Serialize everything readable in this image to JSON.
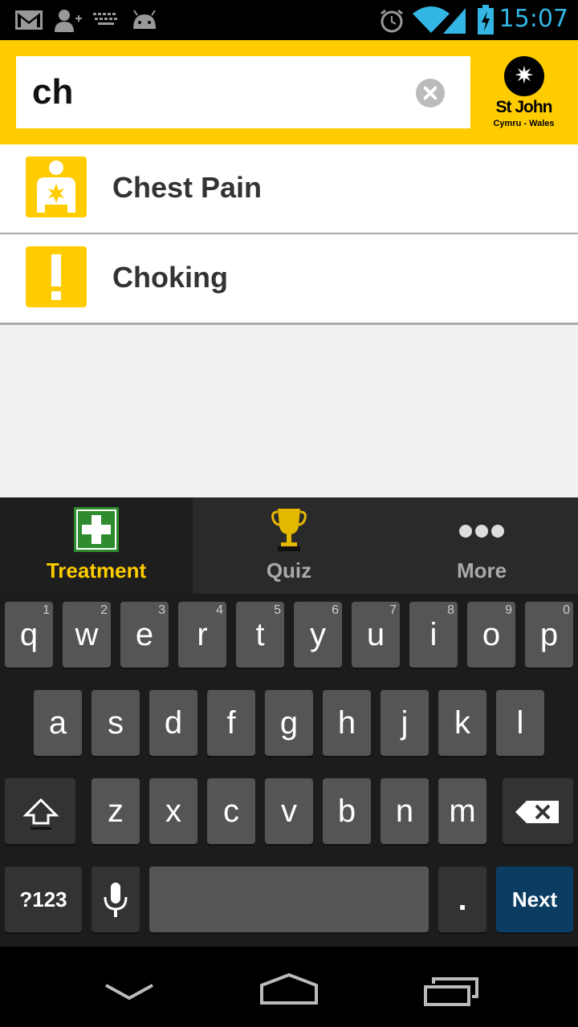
{
  "status_bar": {
    "time": "15:07",
    "icons": [
      "gmail-icon",
      "add-contact-icon",
      "keyboard-icon",
      "android-icon",
      "alarm-icon",
      "wifi-icon",
      "signal-icon",
      "battery-charging-icon"
    ]
  },
  "search": {
    "query": "ch",
    "clear_icon": "clear-search-icon"
  },
  "logo": {
    "name": "St John",
    "subtitle": "Cymru - Wales"
  },
  "results": [
    {
      "label": "Chest Pain",
      "icon": "chest-pain-icon"
    },
    {
      "label": "Choking",
      "icon": "exclamation-icon"
    }
  ],
  "tabs": [
    {
      "label": "Treatment",
      "icon": "first-aid-cross-icon",
      "active": true
    },
    {
      "label": "Quiz",
      "icon": "trophy-icon",
      "active": false
    },
    {
      "label": "More",
      "icon": "more-dots-icon",
      "active": false
    }
  ],
  "keyboard": {
    "row1": [
      {
        "k": "q",
        "n": "1"
      },
      {
        "k": "w",
        "n": "2"
      },
      {
        "k": "e",
        "n": "3"
      },
      {
        "k": "r",
        "n": "4"
      },
      {
        "k": "t",
        "n": "5"
      },
      {
        "k": "y",
        "n": "6"
      },
      {
        "k": "u",
        "n": "7"
      },
      {
        "k": "i",
        "n": "8"
      },
      {
        "k": "o",
        "n": "9"
      },
      {
        "k": "p",
        "n": "0"
      }
    ],
    "row2": [
      "a",
      "s",
      "d",
      "f",
      "g",
      "h",
      "j",
      "k",
      "l"
    ],
    "row3": [
      "z",
      "x",
      "c",
      "v",
      "b",
      "n",
      "m"
    ],
    "symbols_label": "?123",
    "period_label": ".",
    "next_label": "Next"
  },
  "nav": [
    "back-icon",
    "home-icon",
    "recent-apps-icon"
  ],
  "colors": {
    "accent": "#ffcc00",
    "status_blue": "#33b5e5",
    "first_aid_green": "#2e8b2e"
  }
}
